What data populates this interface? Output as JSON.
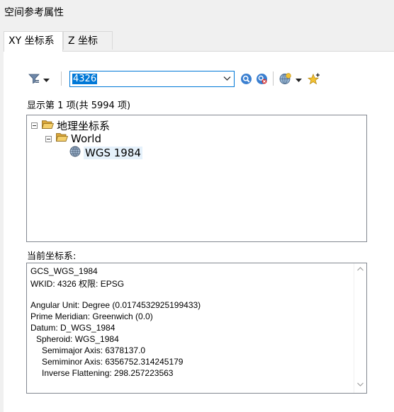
{
  "window": {
    "title": "空间参考属性"
  },
  "tabs": [
    {
      "label": "XY 坐标系",
      "active": true
    },
    {
      "label": "Z 坐标系",
      "active": false
    }
  ],
  "toolbar": {
    "filter_icon": "filter-icon",
    "search_value": "4326",
    "search_icon": "search-icon",
    "clear_search_icon": "clear-search-icon",
    "add_coordinate_system_icon": "globe-add-icon",
    "favorite_icon": "star-add-icon"
  },
  "result_summary": "显示第 1 项(共 5994 项)",
  "tree": {
    "root": {
      "label": "地理坐标系",
      "icon": "folder-open-icon"
    },
    "child": {
      "label": "World",
      "icon": "folder-open-icon"
    },
    "leaf": {
      "label": "WGS 1984",
      "icon": "globe-icon"
    }
  },
  "current_label": "当前坐标系:",
  "details": {
    "lines": [
      "GCS_WGS_1984",
      "WKID: 4326 权限: EPSG",
      "",
      "Angular Unit: Degree (0.0174532925199433)",
      "Prime Meridian: Greenwich (0.0)",
      "Datum: D_WGS_1984",
      "Spheroid: WGS_1984",
      "Semimajor Axis: 6378137.0",
      "Semiminor Axis: 6356752.314245179",
      "Inverse Flattening: 298.257223563"
    ]
  },
  "colors": {
    "accent": "#0078d7",
    "selection": "#e5f1fb",
    "folder": "#e8b84a"
  }
}
